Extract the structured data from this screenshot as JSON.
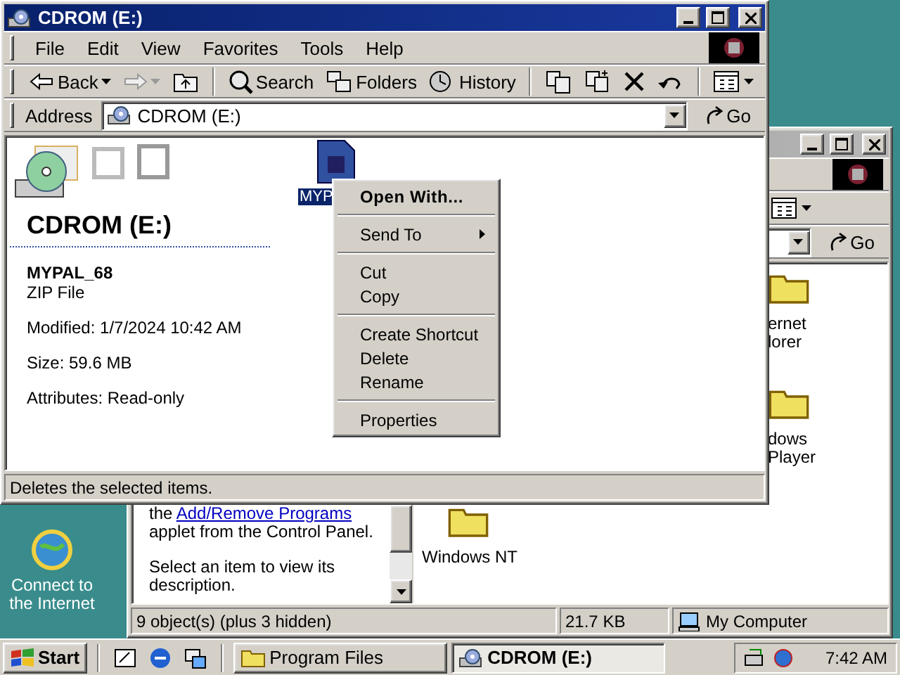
{
  "desktop": {
    "icons": [
      {
        "label": "Connect to the Internet"
      }
    ]
  },
  "back_window": {
    "active": false,
    "toolbar": [
      {
        "kind": "views"
      }
    ],
    "address": {
      "go": "Go"
    },
    "info_panel": [
      {
        "kind": "link_text",
        "before": "the ",
        "link": "Add/Remove Programs",
        "after": " applet from the Control Panel."
      },
      {
        "kind": "text",
        "text": "Select an item to view its description."
      }
    ],
    "folders": [
      {
        "label": "ernet lorer"
      },
      {
        "label": "dows Player"
      },
      {
        "label": "Windows NT"
      }
    ],
    "status_bar": [
      "9 object(s) (plus 3 hidden)",
      "21.7 KB",
      "My Computer"
    ]
  },
  "window": {
    "title": "CDROM (E:)",
    "active": true,
    "menu": [
      "File",
      "Edit",
      "View",
      "Favorites",
      "Tools",
      "Help"
    ],
    "toolbar": [
      {
        "kind": "back",
        "label": "Back",
        "disabled": false
      },
      {
        "kind": "forward",
        "disabled": true
      },
      {
        "kind": "up"
      },
      {
        "kind": "separator"
      },
      {
        "kind": "search",
        "label": "Search"
      },
      {
        "kind": "folders",
        "label": "Folders"
      },
      {
        "kind": "history",
        "label": "History"
      },
      {
        "kind": "separator"
      },
      {
        "kind": "move"
      },
      {
        "kind": "copy"
      },
      {
        "kind": "delete"
      },
      {
        "kind": "undo"
      },
      {
        "kind": "separator"
      },
      {
        "kind": "views"
      }
    ],
    "address": {
      "label": "Address",
      "value": "CDROM (E:)",
      "go": "Go"
    },
    "info_panel": {
      "heading": "CDROM (E:)",
      "file_name": "MYPAL_68",
      "file_type": "ZIP File",
      "details": [
        "Modified: 1/7/2024 10:42 AM",
        "Size: 59.6 MB",
        "Attributes: Read-only"
      ]
    },
    "files": [
      {
        "label": "MYP",
        "selected": true
      }
    ],
    "context_menu": [
      {
        "kind": "item",
        "label": "Open With...",
        "default": true
      },
      {
        "kind": "separator"
      },
      {
        "kind": "submenu",
        "label": "Send To",
        "default": false
      },
      {
        "kind": "separator"
      },
      {
        "kind": "item",
        "label": "Cut",
        "default": false
      },
      {
        "kind": "item",
        "label": "Copy",
        "default": false
      },
      {
        "kind": "separator"
      },
      {
        "kind": "item",
        "label": "Create Shortcut",
        "default": false
      },
      {
        "kind": "item",
        "label": "Delete",
        "default": false
      },
      {
        "kind": "item",
        "label": "Rename",
        "default": false
      },
      {
        "kind": "separator"
      },
      {
        "kind": "item",
        "label": "Properties",
        "default": false
      }
    ],
    "status_bar": "Deletes the selected items."
  },
  "taskbar": {
    "start": "Start",
    "tasks": [
      {
        "label": "Program Files",
        "selected": false
      },
      {
        "label": "CDROM (E:)",
        "selected": true
      }
    ],
    "clock": "7:42 AM"
  }
}
